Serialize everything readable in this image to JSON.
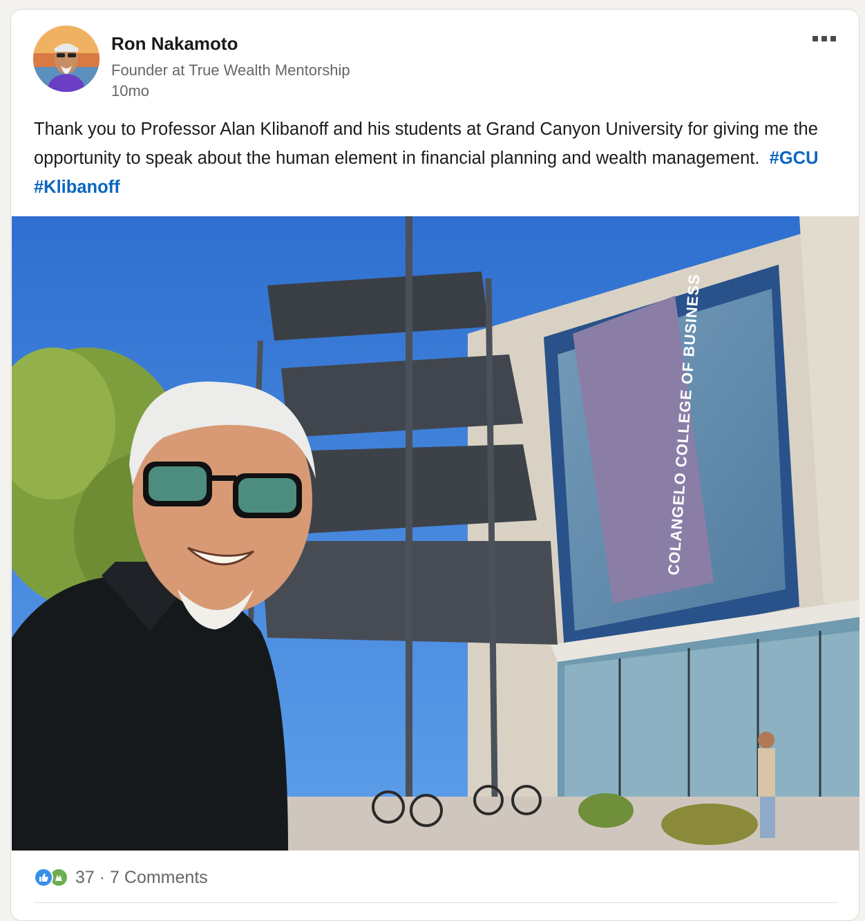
{
  "post": {
    "author": {
      "name": "Ron Nakamoto",
      "headline": "Founder at True Wealth Mentorship",
      "age": "10mo"
    },
    "text": "Thank you to Professor Alan Klibanoff and his students at Grand Canyon University for giving me the opportunity to speak about the human element in financial planning and wealth management.",
    "hashtags": [
      "#GCU",
      "#Klibanoff"
    ],
    "photo": {
      "sign_text": "COLANGELO COLLEGE OF BUSINESS"
    },
    "social": {
      "reaction_count": "37",
      "separator": "·",
      "comments": "7 Comments",
      "reaction_icons": [
        "like-icon",
        "celebrate-icon"
      ]
    }
  },
  "colors": {
    "hashtag": "#0a66c2",
    "sign_purple": "#8a7ea6",
    "sky": "#3d7fd6"
  }
}
